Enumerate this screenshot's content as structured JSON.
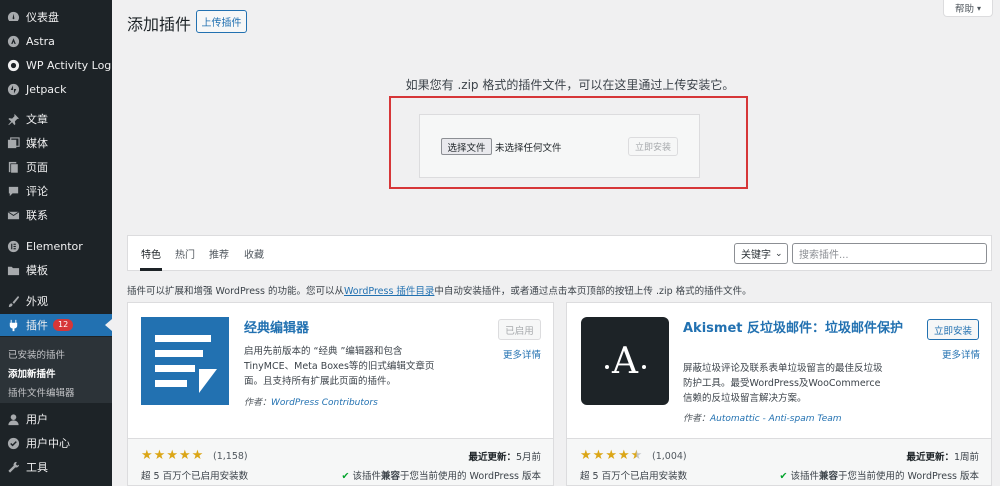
{
  "sidebar": {
    "items": [
      {
        "label": "仪表盘",
        "icon": "dashboard-icon"
      },
      {
        "label": "Astra",
        "icon": "astra-icon"
      },
      {
        "label": "WP Activity Log",
        "icon": "activity-log-icon"
      },
      {
        "label": "Jetpack",
        "icon": "jetpack-icon"
      },
      {
        "label": "文章",
        "icon": "pin-icon"
      },
      {
        "label": "媒体",
        "icon": "media-icon"
      },
      {
        "label": "页面",
        "icon": "page-icon"
      },
      {
        "label": "评论",
        "icon": "comment-icon"
      },
      {
        "label": "联系",
        "icon": "mail-icon"
      },
      {
        "label": "Elementor",
        "icon": "elementor-icon"
      },
      {
        "label": "模板",
        "icon": "folder-icon"
      },
      {
        "label": "外观",
        "icon": "brush-icon"
      },
      {
        "label": "插件",
        "icon": "plugin-icon",
        "badge": "12"
      },
      {
        "label": "用户",
        "icon": "user-icon"
      },
      {
        "label": "用户中心",
        "icon": "user-center-icon"
      },
      {
        "label": "工具",
        "icon": "wrench-icon"
      }
    ],
    "submenu": [
      "已安装的插件",
      "添加新插件",
      "插件文件编辑器"
    ]
  },
  "header": {
    "title": "添加插件",
    "upload_button": "上传插件",
    "help": "帮助"
  },
  "upload": {
    "instruction": "如果您有 .zip 格式的插件文件，可以在这里通过上传安装它。",
    "choose_file": "选择文件",
    "no_file": "未选择任何文件",
    "install_now": "立即安装"
  },
  "filter": {
    "tabs": [
      "特色",
      "热门",
      "推荐",
      "收藏"
    ],
    "search_type": "关键字",
    "search_placeholder": "搜索插件..."
  },
  "intro": {
    "before": "插件可以扩展和增强 WordPress 的功能。您可以从",
    "link": "WordPress 插件目录",
    "after": "中自动安装插件，或者通过点击本页顶部的按钮上传 .zip 格式的插件文件。"
  },
  "plugins": [
    {
      "name": "经典编辑器",
      "description": "启用先前版本的 “经典 ”编辑器和包含TinyMCE、Meta Boxes等的旧式编辑文章页面。且支持所有扩展此页面的插件。",
      "author_label": "作者：",
      "author": "WordPress Contributors",
      "action": "已启用",
      "more": "更多详情",
      "rating": 5,
      "rating_count": "(1,158)",
      "installs": "超 5 百万个已启用安装数",
      "updated_label": "最近更新：",
      "updated": "5月前",
      "compat_before": "该插件",
      "compat_bold": "兼容",
      "compat_after": "于您当前使用的 WordPress 版本"
    },
    {
      "name": "Akismet 反垃圾邮件：垃圾邮件保护",
      "description": "屏蔽垃圾评论及联系表单垃圾留言的最佳反垃圾防护工具。最受WordPress及WooCommerce信赖的反垃圾留言解决方案。",
      "author_label": "作者：",
      "author": "Automattic - Anti-spam Team",
      "action": "立即安装",
      "more": "更多详情",
      "rating": 4.5,
      "rating_count": "(1,004)",
      "installs": "超 5 百万个已启用安装数",
      "updated_label": "最近更新：",
      "updated": "1周前",
      "compat_before": "该插件",
      "compat_bold": "兼容",
      "compat_after": "于您当前使用的 WordPress 版本",
      "icon_letter": "A"
    }
  ],
  "colors": {
    "sidebar_bg": "#1d2327",
    "accent": "#2271b1",
    "highlight_border": "#d63638",
    "star": "#dba617"
  }
}
